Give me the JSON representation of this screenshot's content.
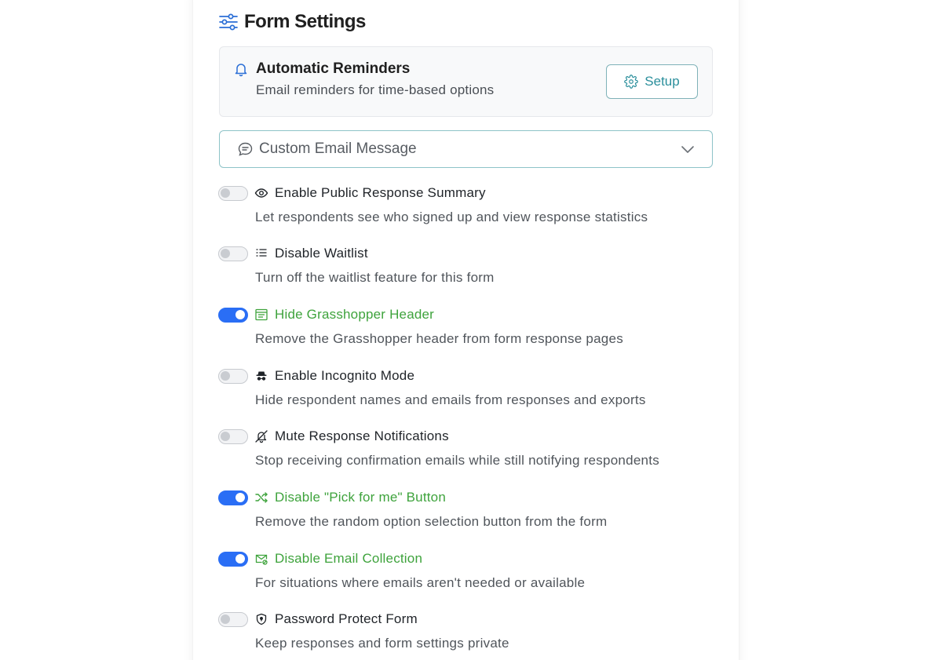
{
  "header": {
    "title": "Form Settings",
    "icon": "sliders-icon"
  },
  "reminders": {
    "title": "Automatic Reminders",
    "subtitle": "Email reminders for time-based options",
    "button_label": "Setup",
    "icon": "bell-icon"
  },
  "email_message": {
    "label": "Custom Email Message",
    "expanded": false
  },
  "colors": {
    "accent": "#2a6ef5",
    "active_label": "#3ea33c",
    "teal": "#2b8f9c"
  },
  "settings": [
    {
      "label": "Enable Public Response Summary",
      "desc": "Let respondents see who signed up and view response statistics",
      "enabled": false,
      "icon": "eye-icon"
    },
    {
      "label": "Disable Waitlist",
      "desc": "Turn off the waitlist feature for this form",
      "enabled": false,
      "icon": "list-icon"
    },
    {
      "label": "Hide Grasshopper Header",
      "desc": "Remove the Grasshopper header from form response pages",
      "enabled": true,
      "icon": "header-layout-icon"
    },
    {
      "label": "Enable Incognito Mode",
      "desc": "Hide respondent names and emails from responses and exports",
      "enabled": false,
      "icon": "incognito-icon"
    },
    {
      "label": "Mute Response Notifications",
      "desc": "Stop receiving confirmation emails while still notifying respondents",
      "enabled": false,
      "icon": "bell-off-icon"
    },
    {
      "label": "Disable \"Pick for me\" Button",
      "desc": "Remove the random option selection button from the form",
      "enabled": true,
      "icon": "shuffle-icon"
    },
    {
      "label": "Disable Email Collection",
      "desc": "For situations where emails aren't needed or available",
      "enabled": true,
      "icon": "mail-off-icon"
    },
    {
      "label": "Password Protect Form",
      "desc": "Keep responses and form settings private",
      "enabled": false,
      "icon": "shield-icon"
    }
  ]
}
